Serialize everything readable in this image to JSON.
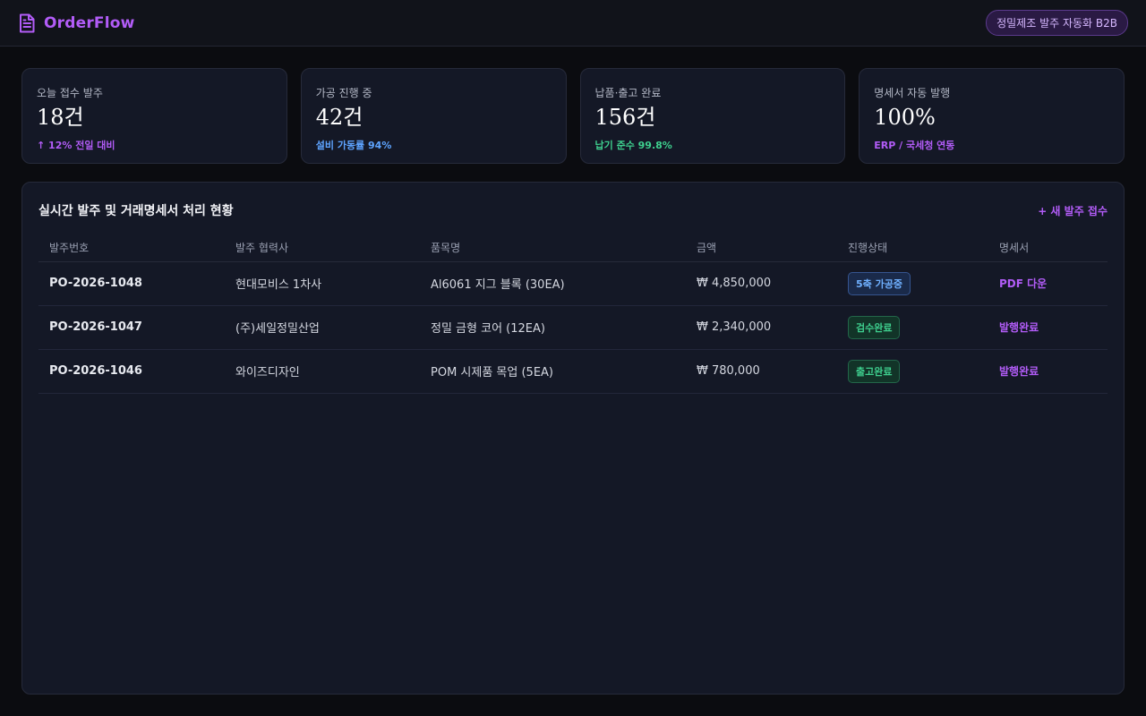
{
  "app": {
    "name": "OrderFlow",
    "tagline": "정밀제조 발주 자동화 B2B"
  },
  "stats": [
    {
      "label": "오늘 접수 발주",
      "value": "18건",
      "sub": "↑ 12% 전일 대비"
    },
    {
      "label": "가공 진행 중",
      "value": "42건",
      "sub": "설비 가동률 94%"
    },
    {
      "label": "납품·출고 완료",
      "value": "156건",
      "sub": "납기 준수 99.8%"
    },
    {
      "label": "명세서 자동 발행",
      "value": "100%",
      "sub": "ERP / 국세청 연동"
    }
  ],
  "panel": {
    "title": "실시간 발주 및 거래명세서 처리 현황",
    "new_order_label": "+ 새 발주 접수",
    "columns": [
      "발주번호",
      "발주 협력사",
      "품목명",
      "금액",
      "진행상태",
      "명세서"
    ],
    "rows": [
      {
        "po": "PO-2026-1048",
        "partner": "현대모비스 1차사",
        "item": "Al6061 지그 블록 (30EA)",
        "amount": "₩ 4,850,000",
        "status": "5축 가공중",
        "doc": "PDF 다운"
      },
      {
        "po": "PO-2026-1047",
        "partner": "(주)세일정밀산업",
        "item": "정밀 금형 코어 (12EA)",
        "amount": "₩ 2,340,000",
        "status": "검수완료",
        "doc": "발행완료"
      },
      {
        "po": "PO-2026-1046",
        "partner": "와이즈디자인",
        "item": "POM 시제품 목업 (5EA)",
        "amount": "₩ 780,000",
        "status": "출고완료",
        "doc": "발행완료"
      }
    ]
  },
  "colors": {
    "accent": "#b25cf7",
    "blue": "#5ea4ff",
    "green": "#3ecf8e"
  }
}
